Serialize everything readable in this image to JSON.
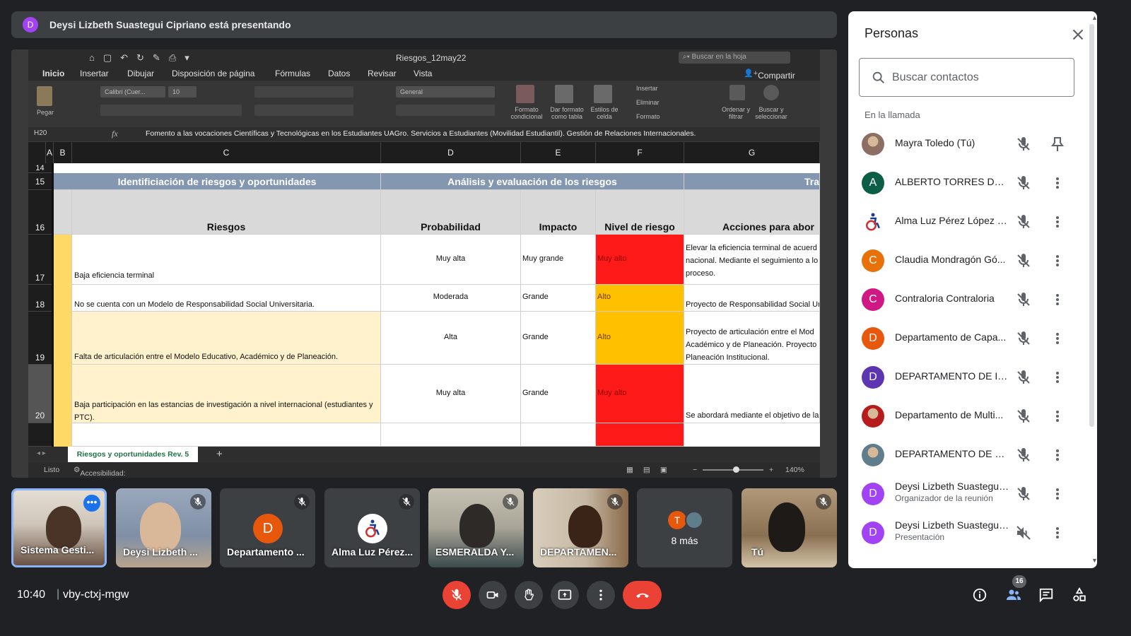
{
  "banner": {
    "avatar": "D",
    "text": "Deysi Lizbeth Suastegui Cipriano está presentando",
    "avatar_color": "#a142f4"
  },
  "excel": {
    "filename": "Riesgos_12may22",
    "search_placeholder": "Buscar en la hoja",
    "tabs": [
      "Inicio",
      "Insertar",
      "Dibujar",
      "Disposición de página",
      "Fórmulas",
      "Datos",
      "Revisar",
      "Vista"
    ],
    "share": "Compartir",
    "ribbon": {
      "paste": "Pegar",
      "font": "Calibri (Cuer...",
      "size": "10",
      "format": "General",
      "cond_format": "Formato condicional",
      "table_format": "Dar formato como tabla",
      "cell_styles": "Estilos de celda",
      "insert": "Insertar",
      "delete": "Eliminar",
      "format_btn": "Formato",
      "sort": "Ordenar y filtrar",
      "find": "Buscar y seleccionar"
    },
    "cell_ref": "H20",
    "formula_text": "Fomento a las vocaciones Científicas y Tecnológicas en los Estudiantes UAGro. Servicios a Estudiantes (Movilidad Estudiantil). Gestión de Relaciones Internacionales.",
    "columns": [
      "A",
      "B",
      "C",
      "D",
      "E",
      "F",
      "G"
    ],
    "row_numbers": [
      "14",
      "15",
      "16",
      "17",
      "18",
      "19",
      "20"
    ],
    "section_headers": {
      "ident": "Identificiación de riesgos y oportunidades",
      "analisis": "Análisis y evaluación de los riesgos",
      "tra": "Tra"
    },
    "col_headers": {
      "riesgos": "Riesgos",
      "probabilidad": "Probabilidad",
      "impacto": "Impacto",
      "nivel": "Nivel de riesgo",
      "acciones": "Acciones para abor"
    },
    "rows": [
      {
        "riesgo": "Baja eficiencia terminal",
        "prob": "Muy alta",
        "impacto": "Muy grande",
        "nivel": "Muy alto",
        "nivel_color": "#ff1a1a",
        "accion1": "Elevar la eficiencia terminal de acuerd",
        "accion2": "nacional. Mediante el seguimiento a lo",
        "accion3": "proceso."
      },
      {
        "riesgo": "No se cuenta con un Modelo de Responsabilidad Social Universitaria.",
        "prob": "Moderada",
        "impacto": "Grande",
        "nivel": "Alto",
        "nivel_color": "#ffc000",
        "accion1": "Proyecto de Responsabilidad Social Un",
        "accion2": "",
        "accion3": ""
      },
      {
        "riesgo": "Falta de articulación entre el Modelo Educativo, Académico y de Planeación.",
        "prob": "Alta",
        "impacto": "Grande",
        "nivel": "Alto",
        "nivel_color": "#ffc000",
        "accion1": "Proyecto de articulación entre el Mod",
        "accion2": "Académico y de Planeación. Proyecto",
        "accion3": "Planeación Institucional."
      },
      {
        "riesgo": "Baja participación en las estancias de investigación a nivel internacional (estudiantes y",
        "riesgo2": "PTC).",
        "prob": "Muy alta",
        "impacto": "Grande",
        "nivel": "Muy alto",
        "nivel_color": "#ff1a1a",
        "accion1": "Se abordará mediante el objetivo de la",
        "accion2": "",
        "accion3": ""
      }
    ],
    "sheet_tab": "Riesgos y oportunidades Rev. 5",
    "status": "Listo",
    "accessibility": "Accesibilidad: es necesario investigar",
    "zoom": "140%"
  },
  "tiles": [
    {
      "name": "Sistema Gesti...",
      "kind": "photo",
      "colors": [
        "#d8d2c8",
        "#5a4638"
      ]
    },
    {
      "name": "Deysi Lizbeth ...",
      "kind": "photo",
      "colors": [
        "#8a9ab0",
        "#c9a98c"
      ]
    },
    {
      "name": "Departamento ...",
      "kind": "avatar",
      "letter": "D",
      "color": "#e8580c"
    },
    {
      "name": "Alma Luz Pérez...",
      "kind": "accessibility"
    },
    {
      "name": "ESMERALDA Y...",
      "kind": "photo",
      "colors": [
        "#b8b4a6",
        "#2e3a3e"
      ]
    },
    {
      "name": "DEPARTAMEN...",
      "kind": "photo",
      "colors": [
        "#c6b8a4",
        "#4a3428"
      ]
    },
    {
      "name": "8 más",
      "kind": "more",
      "letter": "T"
    },
    {
      "name": "Tú",
      "kind": "photo",
      "colors": [
        "#a48c6a",
        "#1e1a18"
      ]
    }
  ],
  "meeting": {
    "time": "10:40",
    "code": "vby-ctxj-mgw",
    "participant_count": "16"
  },
  "panel": {
    "title": "Personas",
    "search_placeholder": "Buscar contactos",
    "section": "En la llamada",
    "people": [
      {
        "name": "Mayra Toledo (Tú)",
        "sub": "",
        "avatar": "photo",
        "color": "#8d6e63",
        "action": "pin"
      },
      {
        "name": "ALBERTO TORRES DEL V...",
        "sub": "",
        "avatar": "A",
        "color": "#0b5e45",
        "action": "more"
      },
      {
        "name": "Alma Luz Pérez López G...",
        "sub": "",
        "avatar": "a11y",
        "color": "#ffffff",
        "action": "more"
      },
      {
        "name": "Claudia Mondragón Gó...",
        "sub": "",
        "avatar": "C",
        "color": "#e8710a",
        "action": "more"
      },
      {
        "name": "Contraloria Contraloria",
        "sub": "",
        "avatar": "C",
        "color": "#d01884",
        "action": "more"
      },
      {
        "name": "Departamento de Capa...",
        "sub": "",
        "avatar": "D",
        "color": "#e8580c",
        "action": "more"
      },
      {
        "name": "DEPARTAMENTO DE INF...",
        "sub": "",
        "avatar": "D",
        "color": "#5e35b1",
        "action": "more"
      },
      {
        "name": "Departamento de Multi...",
        "sub": "",
        "avatar": "photo",
        "color": "#b71c1c",
        "action": "more"
      },
      {
        "name": "DEPARTAMENTO DE PL...",
        "sub": "",
        "avatar": "photo",
        "color": "#607d8b",
        "action": "more"
      },
      {
        "name": "Deysi Lizbeth Suastegui ...",
        "sub": "Organizador de la reunión",
        "avatar": "D",
        "color": "#a142f4",
        "action": "more"
      },
      {
        "name": "Deysi Lizbeth Suastegui ...",
        "sub": "Presentación",
        "avatar": "D",
        "color": "#a142f4",
        "action": "more"
      }
    ]
  }
}
